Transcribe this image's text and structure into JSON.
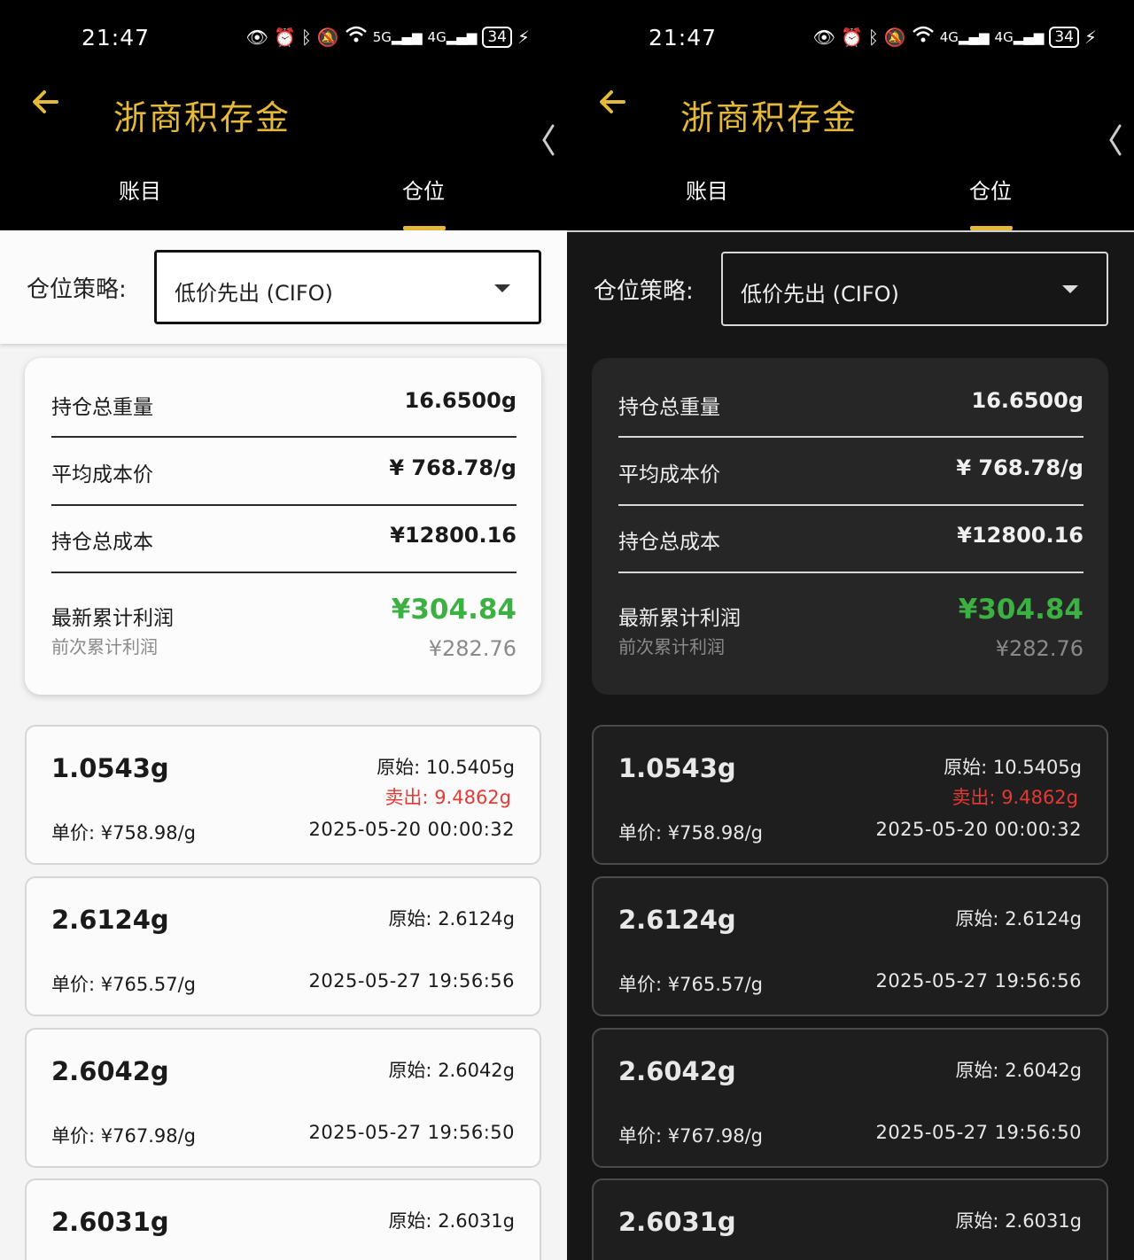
{
  "status": {
    "time": "21:47",
    "battery": "34",
    "signal_5g": "5G",
    "signal_4g": "4G"
  },
  "header": {
    "title": "浙商积存金"
  },
  "tabs": [
    {
      "label": "账目",
      "active": false
    },
    {
      "label": "仓位",
      "active": true
    }
  ],
  "strategy": {
    "label": "仓位策略:",
    "selected": "低价先出 (CIFO)"
  },
  "summary": {
    "total_weight_label": "持仓总重量",
    "total_weight": "16.6500g",
    "avg_cost_label": "平均成本价",
    "avg_cost": "¥ 768.78/g",
    "total_cost_label": "持仓总成本",
    "total_cost": "¥12800.16",
    "latest_profit_label": "最新累计利润",
    "latest_profit": "¥304.84",
    "prev_profit_label": "前次累计利润",
    "prev_profit": "¥282.76"
  },
  "positions": [
    {
      "weight": "1.0543g",
      "original": "原始: 10.5405g",
      "sold": "卖出:  9.4862g",
      "price": "单价: ¥758.98/g",
      "date": "2025-05-20 00:00:32"
    },
    {
      "weight": "2.6124g",
      "original": "原始: 2.6124g",
      "sold": "",
      "price": "单价: ¥765.57/g",
      "date": "2025-05-27 19:56:56"
    },
    {
      "weight": "2.6042g",
      "original": "原始: 2.6042g",
      "sold": "",
      "price": "单价: ¥767.98/g",
      "date": "2025-05-27 19:56:50"
    },
    {
      "weight": "2.6031g",
      "original": "原始: 2.6031g",
      "sold": "",
      "price": "",
      "date": ""
    }
  ],
  "colors": {
    "accent": "#e4b93a",
    "profit": "#3cb043",
    "sold": "#e53935"
  },
  "icons": [
    "back-arrow-icon",
    "chevron-left-icon",
    "eye-icon",
    "alarm-icon",
    "bluetooth-icon",
    "mute-icon",
    "wifi-icon",
    "signal-icon",
    "battery-icon",
    "charging-icon",
    "dropdown-caret-icon"
  ]
}
